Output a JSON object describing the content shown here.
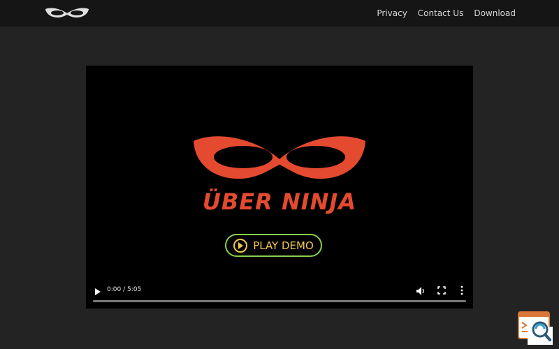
{
  "nav": {
    "logo_icon": "mask-logo-icon",
    "items": [
      {
        "label": "Privacy"
      },
      {
        "label": "Contact Us"
      },
      {
        "label": "Download"
      }
    ]
  },
  "video": {
    "brand_name": "ÜBER NINJA",
    "brand_icon": "ninja-mask-icon",
    "cta_label": "PLAY DEMO",
    "time": "0:00 / 5:05",
    "progress": 0,
    "colors": {
      "brand": "#e44a2f",
      "cta_border": "#8ad04a",
      "cta_text": "#f2c94c"
    }
  },
  "widget": {
    "icon": "search-inspect-icon"
  }
}
